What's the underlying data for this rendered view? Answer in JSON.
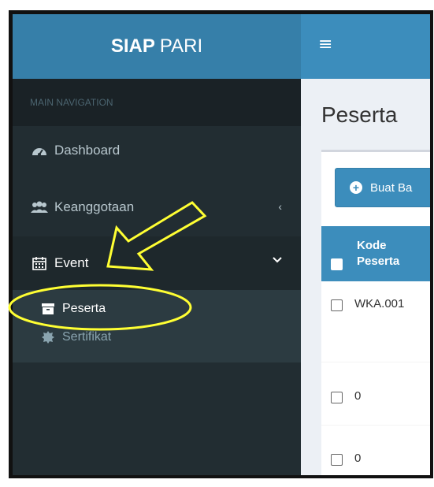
{
  "app": {
    "brand_bold": "SIAP",
    "brand_rest": "PARI",
    "hamburger": "≡"
  },
  "sidebar": {
    "header": "MAIN NAVIGATION",
    "items": [
      {
        "label": "Dashboard",
        "icon": "dashboard-icon"
      },
      {
        "label": "Keanggotaan",
        "icon": "users-icon",
        "arrow": "‹"
      },
      {
        "label": "Event",
        "icon": "calendar-icon",
        "arrow": "⌄"
      }
    ],
    "subitems": [
      {
        "label": "Peserta",
        "icon": "archive-icon"
      },
      {
        "label": "Sertifikat",
        "icon": "certificate-icon"
      }
    ]
  },
  "main": {
    "page_title": "Peserta",
    "new_button": "Buat Ba",
    "table": {
      "header_line1": "Kode",
      "header_line2": "Peserta",
      "rows": [
        "WKA.001",
        "0",
        "0"
      ]
    }
  },
  "colors": {
    "header_blue": "#3c8dbc",
    "logo_blue": "#367fa9",
    "sidebar_dark": "#222d32",
    "annotation": "#ffff33"
  }
}
